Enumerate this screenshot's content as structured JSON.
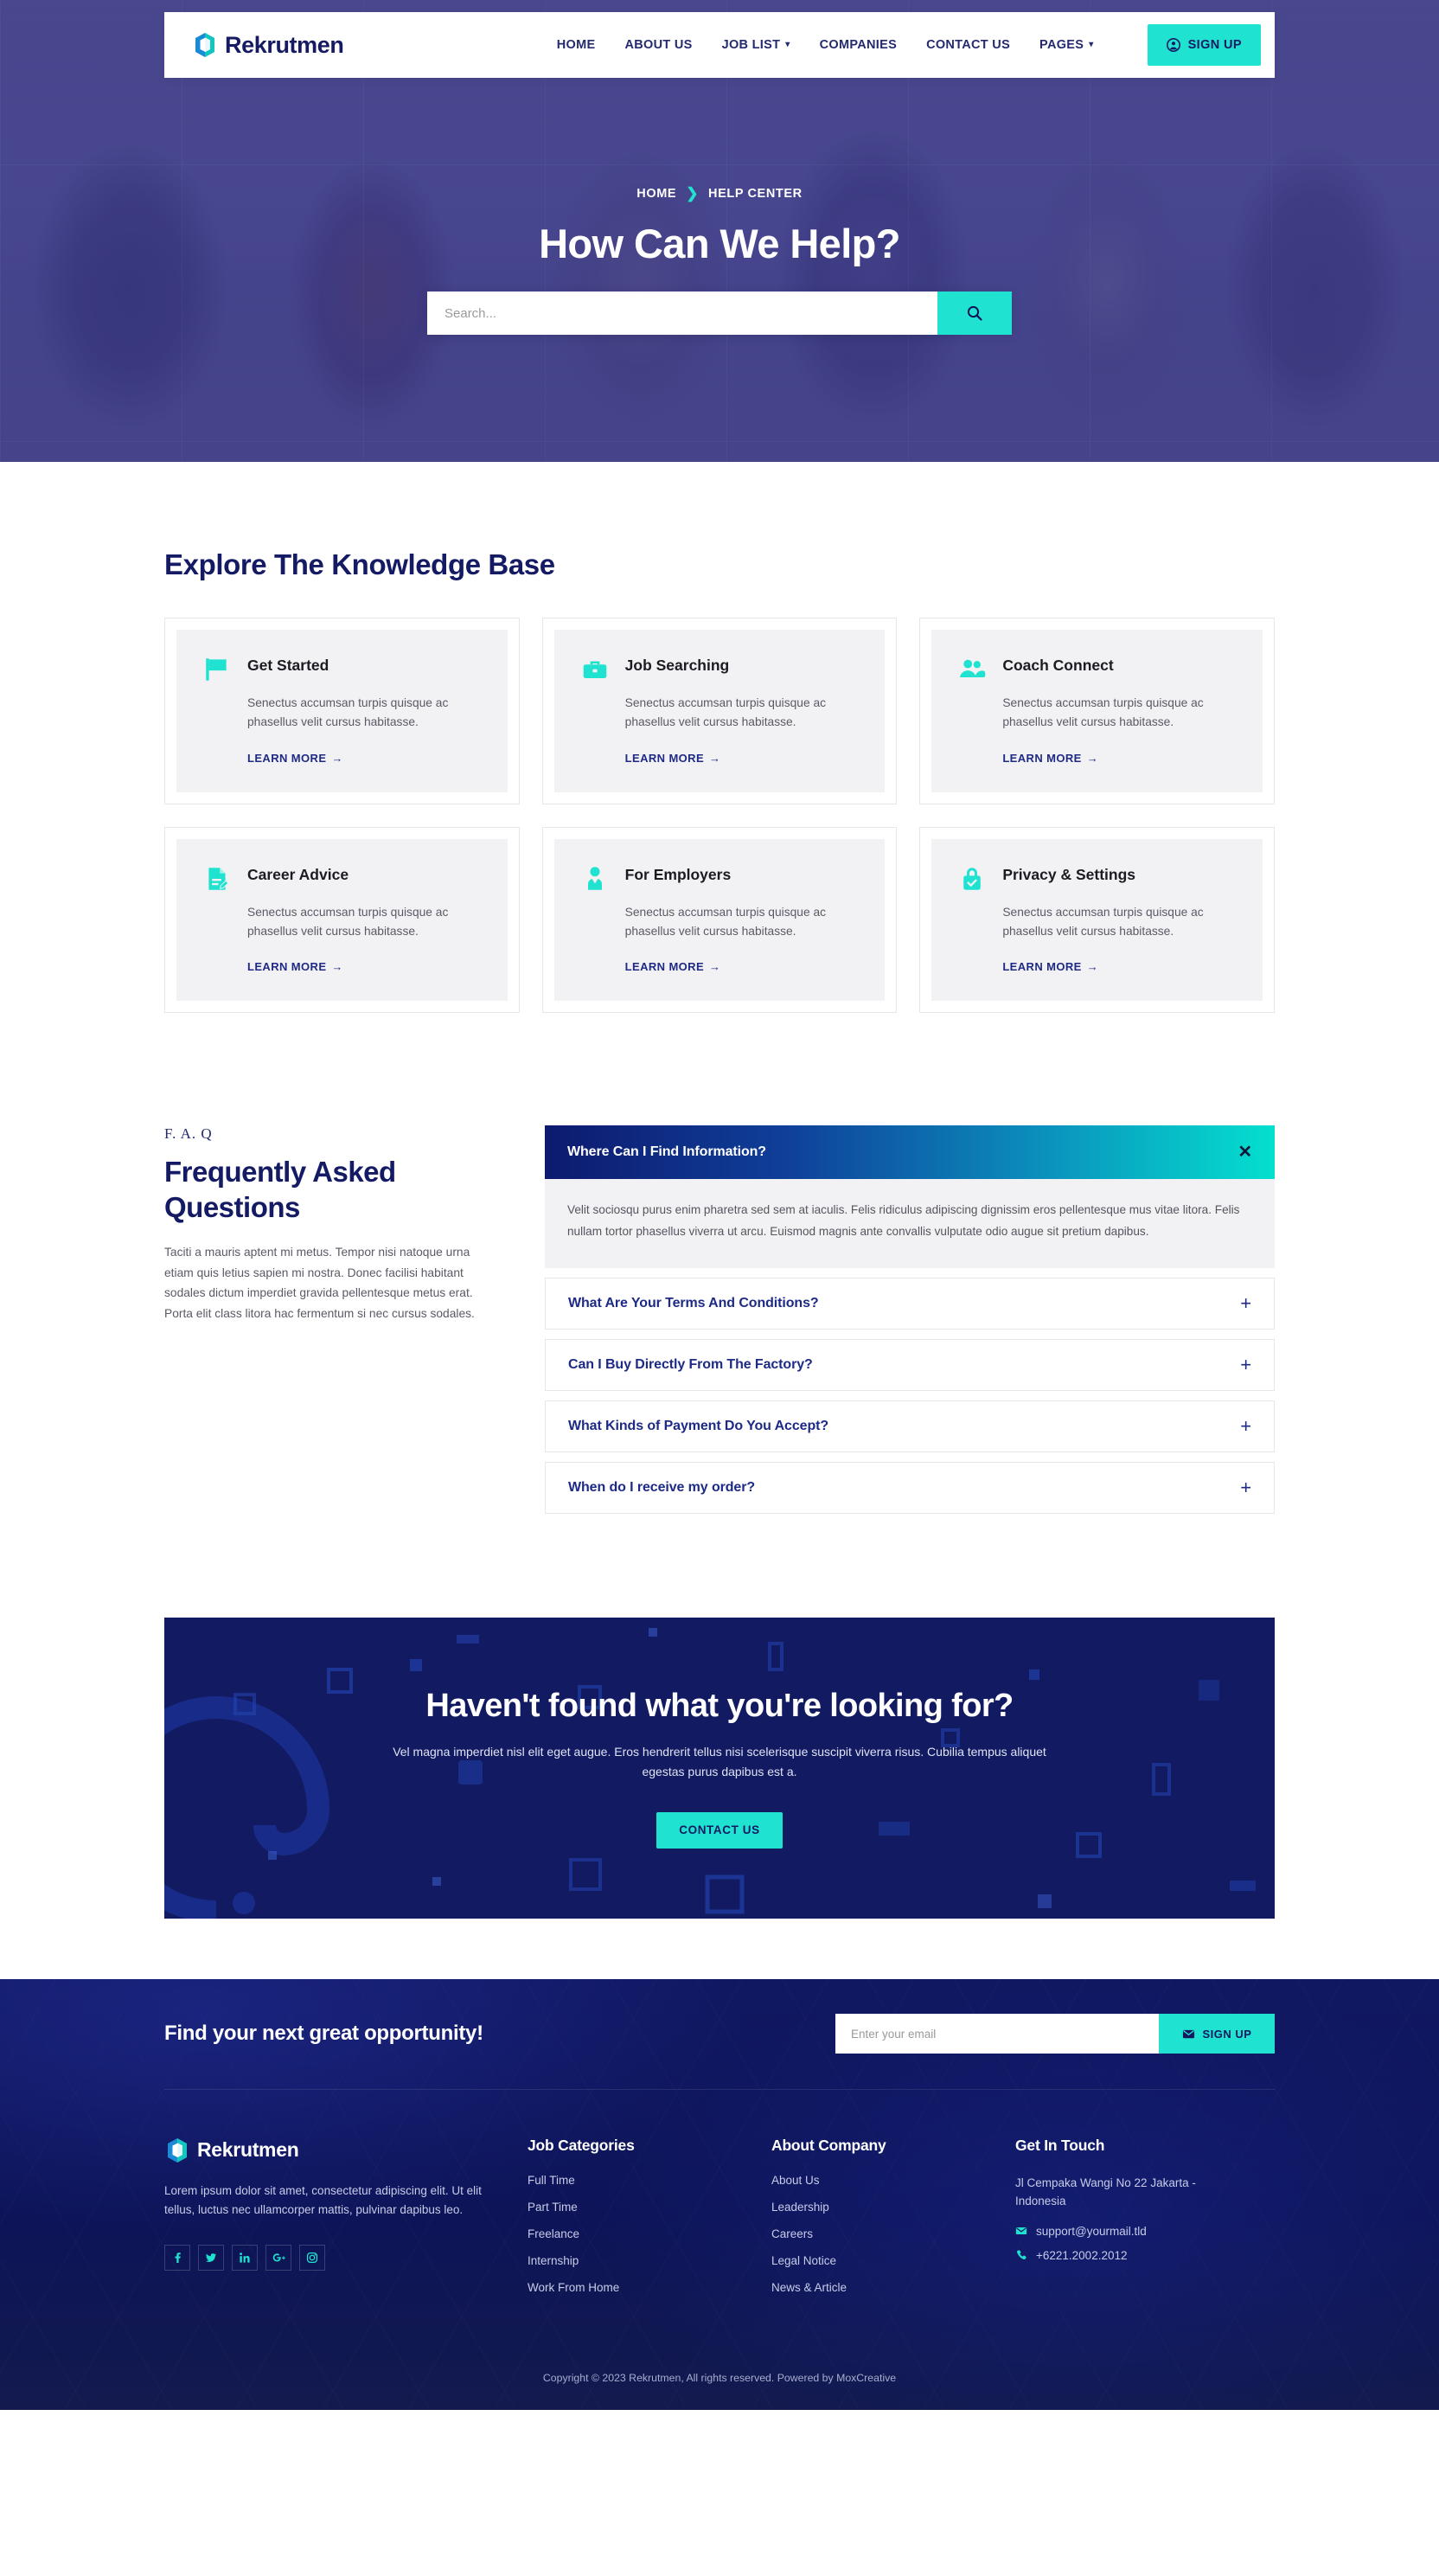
{
  "colors": {
    "brand_navy": "#141a63",
    "accent_cyan": "#1fe3d0",
    "card_bg": "#f2f2f4",
    "footer_navy": "#0c1356",
    "cta_navy": "#121a62"
  },
  "header": {
    "brand": "Rekrutmen",
    "nav": [
      {
        "label": "HOME",
        "has_caret": false
      },
      {
        "label": "ABOUT US",
        "has_caret": false
      },
      {
        "label": "JOB LIST",
        "has_caret": true
      },
      {
        "label": "COMPANIES",
        "has_caret": false
      },
      {
        "label": "CONTACT US",
        "has_caret": false
      },
      {
        "label": "PAGES",
        "has_caret": true
      }
    ],
    "signup_label": "SIGN UP"
  },
  "hero": {
    "breadcrumb_home": "HOME",
    "breadcrumb_current": "HELP CENTER",
    "title": "How Can We Help?",
    "search_placeholder": "Search...",
    "search_value": ""
  },
  "knowledge_base": {
    "title": "Explore The Knowledge Base",
    "learn_more": "LEARN MORE",
    "cards": [
      {
        "icon": "flag-icon",
        "title": "Get Started",
        "desc": "Senectus accumsan turpis quisque ac phasellus velit cursus habitasse.",
        "link": "LEARN MORE"
      },
      {
        "icon": "briefcase-icon",
        "title": "Job Searching",
        "desc": "Senectus accumsan turpis quisque ac phasellus velit cursus habitasse.",
        "link": "LEARN MORE"
      },
      {
        "icon": "people-icon",
        "title": "Coach Connect",
        "desc": "Senectus accumsan turpis quisque ac phasellus velit cursus habitasse.",
        "link": "LEARN MORE"
      },
      {
        "icon": "document-pen-icon",
        "title": "Career Advice",
        "desc": "Senectus accumsan turpis quisque ac phasellus velit cursus habitasse.",
        "link": "LEARN MORE"
      },
      {
        "icon": "user-tie-icon",
        "title": "For Employers",
        "desc": "Senectus accumsan turpis quisque ac phasellus velit cursus habitasse.",
        "link": "LEARN MORE"
      },
      {
        "icon": "lock-check-icon",
        "title": "Privacy & Settings",
        "desc": "Senectus accumsan turpis quisque ac phasellus velit cursus habitasse.",
        "link": "LEARN MORE"
      }
    ]
  },
  "faq": {
    "kicker": "F. A. Q",
    "heading": "Frequently Asked Questions",
    "paragraph": "Taciti a mauris aptent mi metus. Tempor nisi natoque urna etiam quis letius sapien mi nostra. Donec facilisi habitant sodales dictum imperdiet gravida pellentesque metus erat. Porta elit class litora hac fermentum si nec cursus sodales.",
    "items": [
      {
        "question": "Where Can I Find Information?",
        "open": true,
        "sign": "✕",
        "answer": "Velit sociosqu purus enim pharetra sed sem at iaculis. Felis ridiculus adipiscing dignissim eros pellentesque mus vitae litora. Felis nullam tortor phasellus viverra ut arcu. Euismod magnis ante convallis vulputate odio augue sit pretium dapibus."
      },
      {
        "question": "What Are Your Terms And Conditions?",
        "open": false,
        "sign": "+",
        "answer": ""
      },
      {
        "question": "Can I Buy Directly From The Factory?",
        "open": false,
        "sign": "+",
        "answer": ""
      },
      {
        "question": "What Kinds of Payment Do You Accept?",
        "open": false,
        "sign": "+",
        "answer": ""
      },
      {
        "question": "When do I receive my order?",
        "open": false,
        "sign": "+",
        "answer": ""
      }
    ]
  },
  "cta": {
    "heading": "Haven't found what you're looking for?",
    "paragraph": "Vel magna imperdiet nisl elit eget augue. Eros hendrerit tellus nisi scelerisque suscipit viverra risus. Cubilia tempus aliquet egestas purus dapibus est a.",
    "button": "CONTACT US"
  },
  "footer": {
    "newsletter": {
      "heading": "Find your next great opportunity!",
      "placeholder": "Enter your email",
      "value": "",
      "button": "SIGN UP"
    },
    "brand": "Rekrutmen",
    "description": "Lorem ipsum dolor sit amet, consectetur adipiscing elit. Ut elit tellus, luctus nec ullamcorper mattis, pulvinar dapibus leo.",
    "socials": [
      {
        "name": "facebook-icon",
        "glyph": "f"
      },
      {
        "name": "twitter-icon",
        "glyph": "🐦"
      },
      {
        "name": "linkedin-icon",
        "glyph": "in"
      },
      {
        "name": "google-plus-icon",
        "glyph": "g+"
      },
      {
        "name": "instagram-icon",
        "glyph": "▢"
      }
    ],
    "columns": [
      {
        "heading": "Job Categories",
        "links": [
          "Full Time",
          "Part Time",
          "Freelance",
          "Internship",
          "Work From Home"
        ]
      },
      {
        "heading": "About Company",
        "links": [
          "About Us",
          "Leadership",
          "Careers",
          "Legal Notice",
          "News & Article"
        ]
      }
    ],
    "touch": {
      "heading": "Get In Touch",
      "address": "Jl Cempaka Wangi No 22 Jakarta - Indonesia",
      "email": "support@yourmail.tld",
      "phone": "+6221.2002.2012"
    },
    "copyright": "Copyright © 2023 Rekrutmen, All rights reserved. Powered by MoxCreative"
  }
}
